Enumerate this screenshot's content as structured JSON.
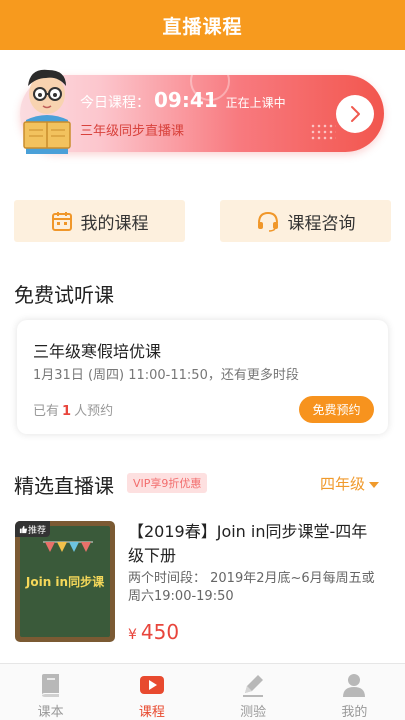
{
  "header": {
    "title": "直播课程"
  },
  "banner": {
    "label": "今日课程：",
    "time": "09:41",
    "status": "正在上课中",
    "course": "三年级同步直播课"
  },
  "quick": {
    "my_courses": "我的课程",
    "consult": "课程咨询"
  },
  "trial": {
    "section_title": "免费试听课",
    "title": "三年级寒假培优课",
    "time": "1月31日 (周四) 11:00-11:50，还有更多时段",
    "count_prefix": "已有",
    "count": "1",
    "count_suffix": "人预约",
    "button": "免费预约"
  },
  "featured": {
    "section_title": "精选直播课",
    "vip_badge": "VIP享9折优惠",
    "grade": "四年级",
    "course": {
      "tag": "推荐",
      "thumb_text": "Join in同步课",
      "title": "【2019春】Join in同步课堂-四年级下册",
      "desc": "两个时间段： 2019年2月底~6月每周五或周六19:00-19:50",
      "currency": "¥",
      "price": "450"
    }
  },
  "tabs": [
    {
      "label": "课本",
      "icon": "book-icon"
    },
    {
      "label": "课程",
      "icon": "play-icon",
      "active": true
    },
    {
      "label": "测验",
      "icon": "pencil-icon"
    },
    {
      "label": "我的",
      "icon": "user-icon"
    }
  ],
  "colors": {
    "accent": "#f79a1e",
    "price": "#e8453c",
    "active_tab": "#e84a2f"
  }
}
